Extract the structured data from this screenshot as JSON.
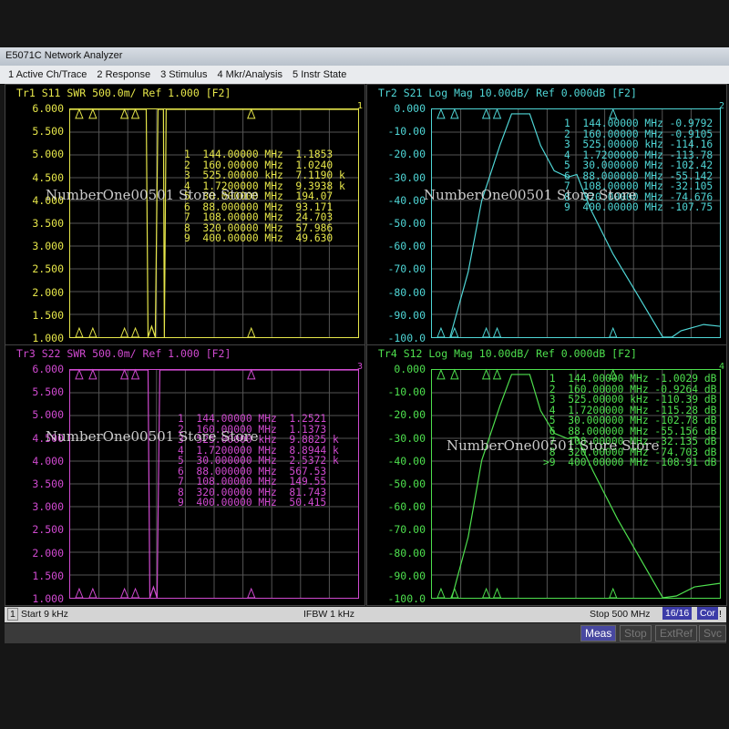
{
  "window": {
    "title": "E5071C Network Analyzer"
  },
  "menu": [
    "1 Active Ch/Trace",
    "2 Response",
    "3 Stimulus",
    "4 Mkr/Analysis",
    "5 Instr State"
  ],
  "panels": [
    {
      "id": "tr1",
      "header": "Tr1 S11 SWR 500.0m/ Ref 1.000 [F2]",
      "color": "#e6e64a",
      "ylabels": [
        "6.000",
        "5.500",
        "5.000",
        "4.500",
        "4.000",
        "3.500",
        "3.000",
        "2.500",
        "2.000",
        "1.500",
        "1.000"
      ],
      "markers": [
        "1  144.00000 MHz  1.1853",
        "2  160.00000 MHz  1.0240",
        "3  525.00000 kHz  7.1190 k",
        "4  1.7200000 MHz  9.3938 k",
        "5  30.000000 MHz  194.07",
        "6  88.000000 MHz  93.171",
        "7  108.00000 MHz  24.703",
        "8  320.00000 MHz  57.986",
        "9  400.00000 MHz  49.630"
      ],
      "ref_marker": "1"
    },
    {
      "id": "tr2",
      "header": "Tr2 S21 Log Mag 10.00dB/ Ref 0.000dB [F2]",
      "color": "#4fd6d6",
      "ylabels": [
        "0.000",
        "-10.00",
        "-20.00",
        "-30.00",
        "-40.00",
        "-50.00",
        "-60.00",
        "-70.00",
        "-80.00",
        "-90.00",
        "-100.0"
      ],
      "markers": [
        "1  144.00000 MHz -0.9792",
        "2  160.00000 MHz -0.9105",
        "3  525.00000 kHz -114.16",
        "4  1.7200000 MHz -113.78",
        "5  30.000000 MHz -102.42",
        "6  88.000000 MHz -55.142",
        "7  108.00000 MHz -32.105",
        "8  320.00000 MHz -74.676",
        "9  400.00000 MHz -107.75"
      ],
      "ref_marker": "2"
    },
    {
      "id": "tr3",
      "header": "Tr3 S22 SWR 500.0m/ Ref 1.000 [F2]",
      "color": "#d04ad0",
      "ylabels": [
        "6.000",
        "5.500",
        "5.000",
        "4.500",
        "4.000",
        "3.500",
        "3.000",
        "2.500",
        "2.000",
        "1.500",
        "1.000"
      ],
      "markers": [
        "1  144.00000 MHz  1.2521",
        "2  160.00000 MHz  1.1373",
        "3  525.00000 kHz  9.8825 k",
        "4  1.7200000 MHz  8.8944 k",
        "5  30.000000 MHz  2.5372 k",
        "6  88.000000 MHz  567.53",
        "7  108.00000 MHz  149.55",
        "8  320.00000 MHz  81.743",
        "9  400.00000 MHz  50.415"
      ],
      "ref_marker": "3"
    },
    {
      "id": "tr4",
      "header": "Tr4 S12 Log Mag 10.00dB/ Ref 0.000dB [F2]",
      "color": "#4ee04e",
      "ylabels": [
        "0.000",
        "-10.00",
        "-20.00",
        "-30.00",
        "-40.00",
        "-50.00",
        "-60.00",
        "-70.00",
        "-80.00",
        "-90.00",
        "-100.0"
      ],
      "markers": [
        " 1  144.00000 MHz -1.0029 dB",
        " 2  160.00000 MHz -0.9264 dB",
        " 3  525.00000 kHz -110.39 dB",
        " 4  1.7200000 MHz -115.28 dB",
        " 5  30.000000 MHz -102.78 dB",
        " 6  88.000000 MHz -55.156 dB",
        " 7  108.00000 MHz -32.135 dB",
        " 8  320.00000 MHz -74.703 dB",
        ">9  400.00000 MHz -108.91 dB"
      ],
      "ref_marker": "4"
    }
  ],
  "status": {
    "channel": "1",
    "start": "Start 9 kHz",
    "ifbw": "IFBW 1 kHz",
    "stop": "Stop 500 MHz",
    "sweep": "16/16",
    "cor": "Cor",
    "flag": "!"
  },
  "bottom": {
    "meas": "Meas",
    "stop": "Stop",
    "extref": "ExtRef",
    "svc": "Svc"
  },
  "watermark": "NumberOne00501 Store Store"
}
